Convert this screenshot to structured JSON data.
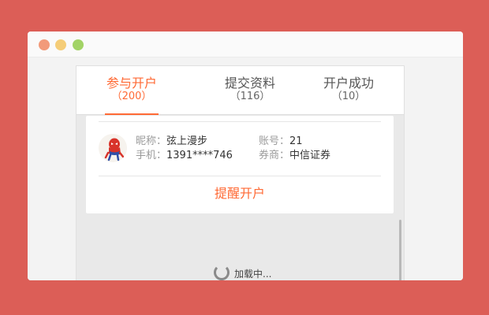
{
  "tabs": [
    {
      "label": "参与开户",
      "count": "（200）",
      "active": true
    },
    {
      "label": "提交资料",
      "count": "（116）",
      "active": false
    },
    {
      "label": "开户成功",
      "count": "（10）",
      "active": false
    }
  ],
  "user": {
    "nickname_label": "昵称：",
    "nickname": "弦上漫步",
    "phone_label": "手机：",
    "phone": "1391****746",
    "account_label": "账号：",
    "account": "21",
    "broker_label": "券商：",
    "broker": "中信证券"
  },
  "remind_button": "提醒开户",
  "loading_text": "加载中...",
  "colors": {
    "accent": "#ff6a35",
    "background": "#dc5e57"
  }
}
